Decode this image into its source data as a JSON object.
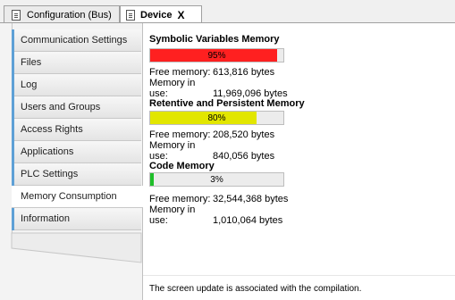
{
  "tabs": [
    {
      "label": "Configuration (Bus)",
      "icon": "document-icon"
    },
    {
      "label": "Device",
      "icon": "document-icon",
      "close": "X"
    }
  ],
  "nav": {
    "items": [
      {
        "label": "Communication Settings"
      },
      {
        "label": "Files"
      },
      {
        "label": "Log"
      },
      {
        "label": "Users and Groups"
      },
      {
        "label": "Access Rights"
      },
      {
        "label": "Applications"
      },
      {
        "label": "PLC Settings"
      },
      {
        "label": "Memory Consumption",
        "active": true
      },
      {
        "label": "Information"
      }
    ]
  },
  "memory": {
    "symbolic": {
      "title": "Symbolic Variables Memory",
      "percent_label": "95%",
      "percent": 95,
      "color": "#ff2020",
      "free_label": "Free memory:",
      "free_value": "613,816 bytes",
      "inuse_label": "Memory in use:",
      "inuse_value": "11,969,096 bytes"
    },
    "retentive": {
      "title": "Retentive and Persistent Memory",
      "percent_label": "80%",
      "percent": 80,
      "color": "#e2e600",
      "free_label": "Free memory:",
      "free_value": "208,520 bytes",
      "inuse_label": "Memory in use:",
      "inuse_value": "840,056 bytes"
    },
    "code": {
      "title": "Code Memory",
      "percent_label": "3%",
      "percent": 3,
      "color": "#1fbf2a",
      "free_label": "Free memory:",
      "free_value": "32,544,368 bytes",
      "inuse_label": "Memory in use:",
      "inuse_value": "1,010,064 bytes"
    }
  },
  "status": {
    "text": "The screen update is associated with the compilation."
  }
}
